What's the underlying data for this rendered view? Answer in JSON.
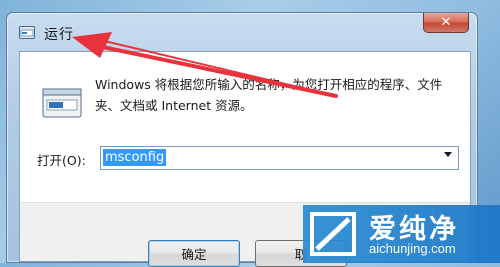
{
  "dialog": {
    "title": "运行",
    "close_glyph": "✕",
    "description": "Windows 将根据您所输入的名称，为您打开相应的程序、文件夹、文档或 Internet 资源。",
    "open_label": "打开(O):",
    "command_value": "msconfig",
    "ok_label": "确定",
    "cancel_label": "取"
  },
  "watermark": {
    "name": "爱纯净",
    "url": "aichunjing.com"
  },
  "colors": {
    "annotation_arrow": "#e8323c",
    "selection": "#3399ff",
    "watermark_bg": "#1f7fc8"
  },
  "icons": {
    "title": "run-dialog-icon",
    "run": "run-program-icon",
    "dropdown": "chevron-down-icon",
    "close": "close-icon"
  }
}
